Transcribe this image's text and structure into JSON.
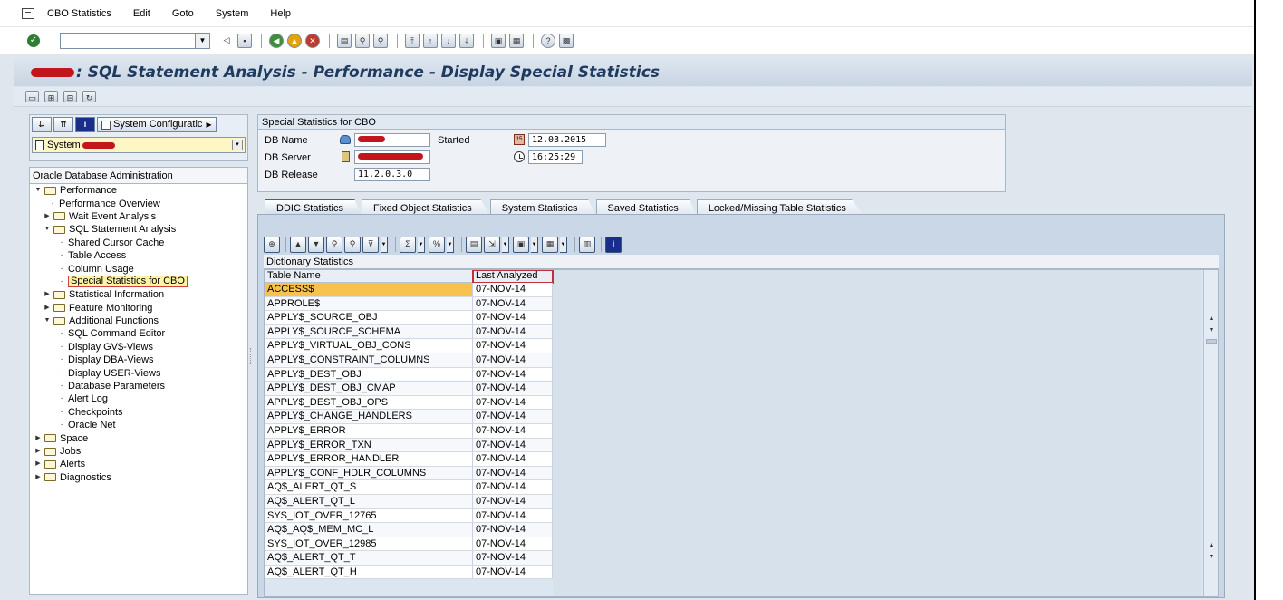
{
  "menubar": {
    "items": [
      "CBO Statistics",
      "Edit",
      "Goto",
      "System",
      "Help"
    ]
  },
  "toolbar": {
    "ok_icon": "check-icon",
    "command_field": ""
  },
  "title": {
    "prefix_redacted": true,
    "text": ": SQL Statement Analysis - Performance - Display Special Statistics"
  },
  "nav": {
    "system_configuration": "System Configuratic",
    "system_field": "System",
    "tree_header": "Oracle Database Administration",
    "tree": [
      {
        "label": "Performance",
        "level": 0,
        "type": "folder",
        "expanded": true
      },
      {
        "label": "Performance Overview",
        "level": 1,
        "type": "leaf"
      },
      {
        "label": "Wait Event Analysis",
        "level": 1,
        "type": "folder",
        "expanded": false
      },
      {
        "label": "SQL Statement Analysis",
        "level": 1,
        "type": "folder",
        "expanded": true
      },
      {
        "label": "Shared Cursor Cache",
        "level": 2,
        "type": "leaf"
      },
      {
        "label": "Table Access",
        "level": 2,
        "type": "leaf"
      },
      {
        "label": "Column Usage",
        "level": 2,
        "type": "leaf"
      },
      {
        "label": "Special Statistics for CBO",
        "level": 2,
        "type": "leaf",
        "selected": true
      },
      {
        "label": "Statistical Information",
        "level": 1,
        "type": "folder",
        "expanded": false
      },
      {
        "label": "Feature Monitoring",
        "level": 1,
        "type": "folder",
        "expanded": false
      },
      {
        "label": "Additional Functions",
        "level": 1,
        "type": "folder-open",
        "expanded": true
      },
      {
        "label": "SQL Command Editor",
        "level": 2,
        "type": "leaf"
      },
      {
        "label": "Display GV$-Views",
        "level": 2,
        "type": "leaf"
      },
      {
        "label": "Display DBA-Views",
        "level": 2,
        "type": "leaf"
      },
      {
        "label": "Display USER-Views",
        "level": 2,
        "type": "leaf"
      },
      {
        "label": "Database Parameters",
        "level": 2,
        "type": "leaf"
      },
      {
        "label": "Alert Log",
        "level": 2,
        "type": "leaf"
      },
      {
        "label": "Checkpoints",
        "level": 2,
        "type": "leaf"
      },
      {
        "label": "Oracle Net",
        "level": 2,
        "type": "leaf"
      },
      {
        "label": "Space",
        "level": 0,
        "type": "folder",
        "expanded": false
      },
      {
        "label": "Jobs",
        "level": 0,
        "type": "folder",
        "expanded": false
      },
      {
        "label": "Alerts",
        "level": 0,
        "type": "folder",
        "expanded": false
      },
      {
        "label": "Diagnostics",
        "level": 0,
        "type": "folder",
        "expanded": false
      }
    ]
  },
  "header": {
    "group_title": "Special Statistics for CBO",
    "db_name_label": "DB Name",
    "db_server_label": "DB Server",
    "db_release_label": "DB Release",
    "db_release": "11.2.0.3.0",
    "started_label": "Started",
    "started_date": "12.03.2015",
    "started_time": "16:25:29"
  },
  "tabs": [
    {
      "label": "DDIC Statistics",
      "active": true
    },
    {
      "label": "Fixed Object Statistics",
      "active": false
    },
    {
      "label": "System Statistics",
      "active": false
    },
    {
      "label": "Saved Statistics",
      "active": false
    },
    {
      "label": "Locked/Missing Table Statistics",
      "active": false
    }
  ],
  "grid": {
    "title": "Dictionary Statistics",
    "columns": [
      "Table Name",
      "Last Analyzed"
    ],
    "rows": [
      [
        "ACCESS$",
        "07-NOV-14"
      ],
      [
        "APPROLE$",
        "07-NOV-14"
      ],
      [
        "APPLY$_SOURCE_OBJ",
        "07-NOV-14"
      ],
      [
        "APPLY$_SOURCE_SCHEMA",
        "07-NOV-14"
      ],
      [
        "APPLY$_VIRTUAL_OBJ_CONS",
        "07-NOV-14"
      ],
      [
        "APPLY$_CONSTRAINT_COLUMNS",
        "07-NOV-14"
      ],
      [
        "APPLY$_DEST_OBJ",
        "07-NOV-14"
      ],
      [
        "APPLY$_DEST_OBJ_CMAP",
        "07-NOV-14"
      ],
      [
        "APPLY$_DEST_OBJ_OPS",
        "07-NOV-14"
      ],
      [
        "APPLY$_CHANGE_HANDLERS",
        "07-NOV-14"
      ],
      [
        "APPLY$_ERROR",
        "07-NOV-14"
      ],
      [
        "APPLY$_ERROR_TXN",
        "07-NOV-14"
      ],
      [
        "APPLY$_ERROR_HANDLER",
        "07-NOV-14"
      ],
      [
        "APPLY$_CONF_HDLR_COLUMNS",
        "07-NOV-14"
      ],
      [
        "AQ$_ALERT_QT_S",
        "07-NOV-14"
      ],
      [
        "AQ$_ALERT_QT_L",
        "07-NOV-14"
      ],
      [
        "SYS_IOT_OVER_12765",
        "07-NOV-14"
      ],
      [
        "AQ$_AQ$_MEM_MC_L",
        "07-NOV-14"
      ],
      [
        "SYS_IOT_OVER_12985",
        "07-NOV-14"
      ],
      [
        "AQ$_ALERT_QT_T",
        "07-NOV-14"
      ],
      [
        "AQ$_ALERT_QT_H",
        "07-NOV-14"
      ]
    ]
  },
  "colors": {
    "highlight_border": "#c0303a",
    "selected_cell": "#f7c24d",
    "title_text": "#1f3a5f"
  }
}
